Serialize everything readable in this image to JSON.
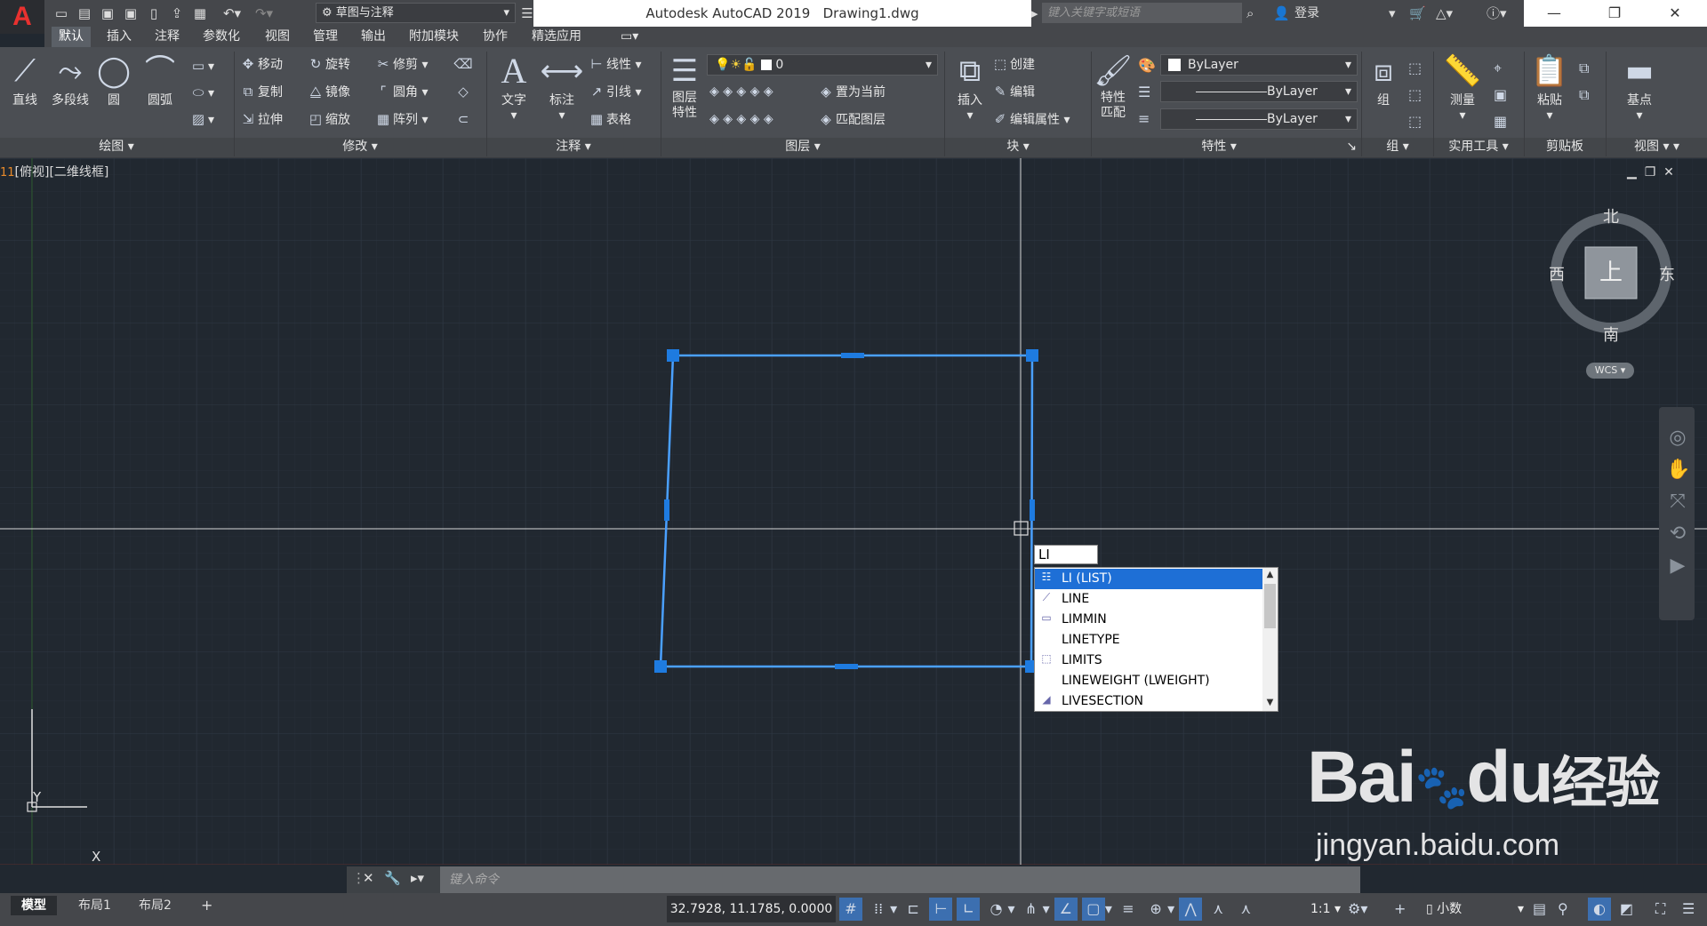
{
  "app": {
    "title": "Autodesk AutoCAD 2019",
    "file": "Drawing1.dwg",
    "logo": "A"
  },
  "quick_access": {
    "workspace": "草图与注释"
  },
  "search": {
    "placeholder": "键入关键字或短语"
  },
  "signin": "登录",
  "tabs": [
    "默认",
    "插入",
    "注释",
    "参数化",
    "视图",
    "管理",
    "输出",
    "附加模块",
    "协作",
    "精选应用"
  ],
  "ribbon": {
    "draw": {
      "label": "绘图",
      "line": "直线",
      "polyline": "多段线",
      "circle": "圆",
      "arc": "圆弧"
    },
    "modify": {
      "label": "修改",
      "move": "移动",
      "rotate": "旋转",
      "trim": "修剪",
      "copy": "复制",
      "mirror": "镜像",
      "fillet": "圆角",
      "stretch": "拉伸",
      "scale": "缩放",
      "array": "阵列"
    },
    "annotation": {
      "label": "注释",
      "text": "文字",
      "dimension": "标注",
      "linear": "线性",
      "leader": "引线",
      "table": "表格"
    },
    "layers": {
      "label": "图层",
      "properties": "图层\n特性",
      "current_layer": "0",
      "set_current": "置为当前",
      "match_layer": "匹配图层"
    },
    "block": {
      "label": "块",
      "insert": "插入",
      "create": "创建",
      "edit": "编辑",
      "edit_attr": "编辑属性"
    },
    "properties": {
      "label": "特性",
      "match": "特性\n匹配",
      "color": "ByLayer",
      "linetype": "ByLayer",
      "lineweight": "ByLayer"
    },
    "groups": {
      "label": "组",
      "group": "组"
    },
    "utilities": {
      "label": "实用工具",
      "measure": "测量"
    },
    "clipboard": {
      "label": "剪贴板",
      "paste": "粘贴"
    },
    "view": {
      "label": "视图",
      "base": "基点"
    }
  },
  "viewport": {
    "number": "11",
    "label": "[俯视][二维线框]"
  },
  "navcube": {
    "north": "北",
    "south": "南",
    "east": "东",
    "west": "西",
    "top": "上",
    "wcs": "WCS"
  },
  "ucs": {
    "y": "Y",
    "x": "X"
  },
  "dynamic_input": {
    "value": "LI"
  },
  "autocomplete": [
    {
      "label": "LI (LIST)",
      "selected": true
    },
    {
      "label": "LINE",
      "selected": false
    },
    {
      "label": "LIMMIN",
      "selected": false
    },
    {
      "label": "LINETYPE",
      "selected": false
    },
    {
      "label": "LIMITS",
      "selected": false
    },
    {
      "label": "LINEWEIGHT (LWEIGHT)",
      "selected": false
    },
    {
      "label": "LIVESECTION",
      "selected": false
    }
  ],
  "command_line": {
    "placeholder": "键入命令"
  },
  "layout_tabs": [
    "模型",
    "布局1",
    "布局2"
  ],
  "status": {
    "coords": "32.7928, 11.1785, 0.0000",
    "scale": "1:1",
    "units": "小数"
  },
  "watermark": {
    "brand": "Bai",
    "brand2": "du",
    "text": "经验",
    "url": "jingyan.baidu.com"
  },
  "colors": {
    "accent": "#1e6fd6",
    "selection": "#2d8cf0",
    "background": "#212830"
  }
}
